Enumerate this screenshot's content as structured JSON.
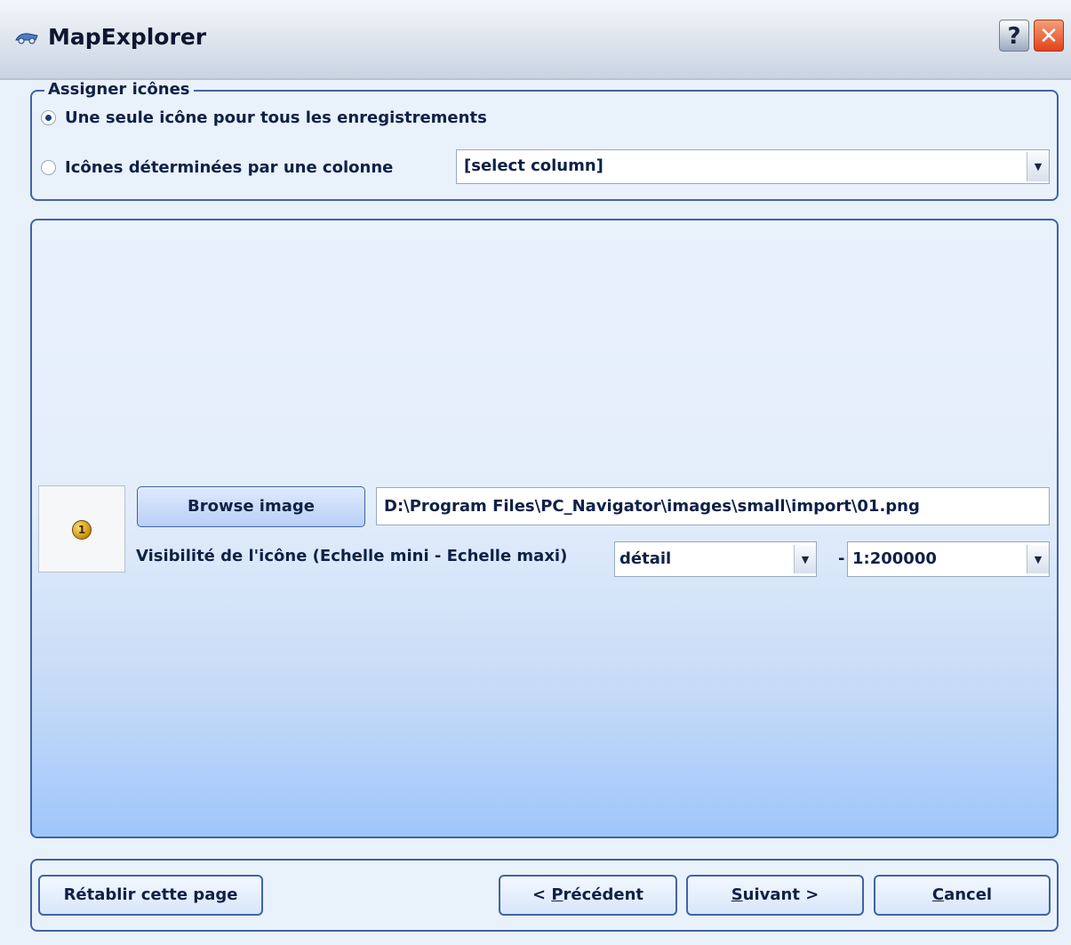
{
  "window": {
    "title": "MapExplorer",
    "help_label": "?",
    "close_label": "✕"
  },
  "assign_icons": {
    "legend": "Assigner icônes",
    "option_single": "Une seule icône pour tous les enregistrements",
    "option_single_checked": true,
    "option_column": "Icônes déterminées par une colonne",
    "option_column_checked": false,
    "column_select_value": "[select column]"
  },
  "icon_settings": {
    "browse_label": "Browse image",
    "image_path": "D:\\Program Files\\PC_Navigator\\images\\small\\import\\01.png",
    "visibility_label": "Visibilité de l'icône (Echelle mini - Echelle maxi)",
    "scale_min": "détail",
    "separator": "-",
    "scale_max": "1:200000",
    "preview_icon": "gold-coin-icon"
  },
  "footer": {
    "reset_label": "Rétablir cette page",
    "prev_prefix": "< ",
    "prev_accel": "P",
    "prev_rest": "récédent",
    "next_accel": "S",
    "next_rest": "uivant >",
    "cancel_accel": "C",
    "cancel_rest": "ancel"
  },
  "colors": {
    "border_blue": "#3f64a6",
    "text_navy": "#0e2147",
    "close_red": "#e2411c"
  }
}
